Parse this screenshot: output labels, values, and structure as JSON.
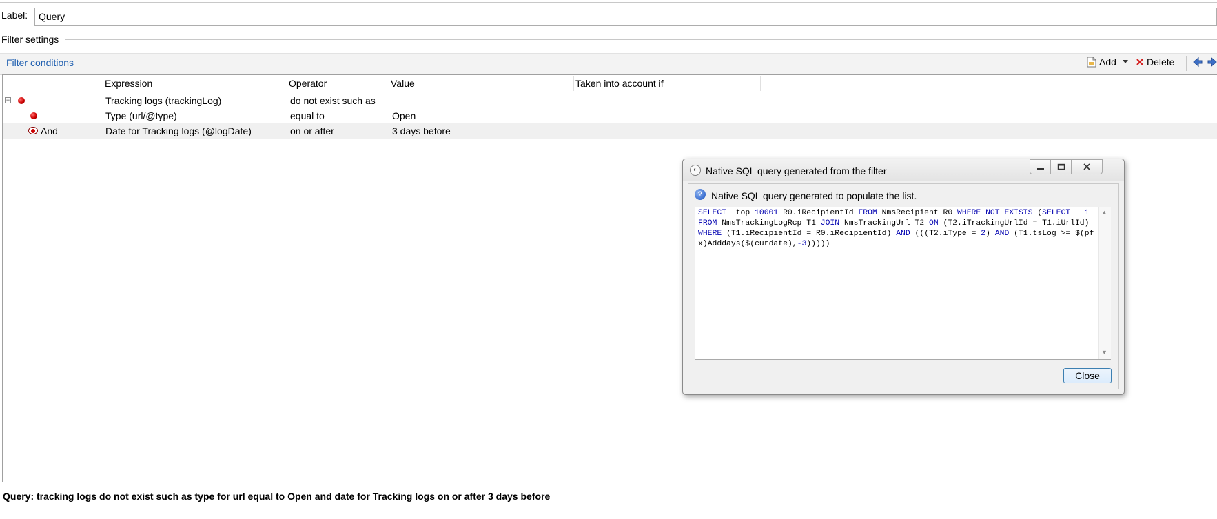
{
  "form": {
    "label_caption": "Label:",
    "label_value": "Query",
    "filter_settings_title": "Filter settings"
  },
  "toolbar": {
    "filter_conditions_link": "Filter conditions",
    "add_label": "Add",
    "delete_label": "Delete",
    "icons": [
      "add-document-icon",
      "dropdown-arrow-icon",
      "delete-x-icon",
      "arrow-left-icon",
      "arrow-right-icon"
    ]
  },
  "grid": {
    "columns": [
      "Expression",
      "Operator",
      "Value",
      "Taken into account if"
    ],
    "rows": [
      {
        "prefix": "",
        "expression": "Tracking logs (trackingLog)",
        "operator": "do not exist such as",
        "value": "",
        "condition": ""
      },
      {
        "prefix": "",
        "expression": "Type (url/@type)",
        "operator": "equal to",
        "value": "Open",
        "condition": ""
      },
      {
        "prefix": "And",
        "expression": "Date for Tracking logs (@logDate)",
        "operator": "on or after",
        "value": "3 days before",
        "condition": ""
      }
    ]
  },
  "status": {
    "summary": "Query: tracking logs do not exist such as type for url equal to Open and date for Tracking logs on or after 3 days before"
  },
  "dialog": {
    "title": "Native SQL query generated from the filter",
    "message": "Native SQL query generated to populate the list.",
    "sql": "SELECT  top 10001 R0.iRecipientId FROM NmsRecipient R0 WHERE NOT EXISTS (SELECT   1 FROM NmsTrackingLogRcp T1 JOIN NmsTrackingUrl T2 ON (T2.iTrackingUrlId = T1.iUrlId) WHERE (T1.iRecipientId = R0.iRecipientId) AND (((T2.iType = 2) AND (T1.tsLog >= $(pfx)Adddays($(curdate),-3)))))",
    "close_label": "Close"
  },
  "colors": {
    "link_blue": "#1f5fb0",
    "sql_keyword": "#0000b0",
    "status_dot": "#cc0000"
  }
}
